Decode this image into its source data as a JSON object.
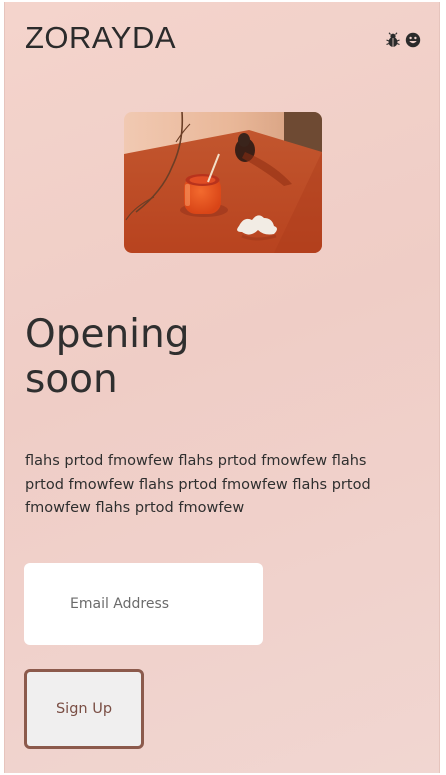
{
  "header": {
    "brand": "ZORAYDA",
    "icons": [
      "bug-icon",
      "smiley-icon"
    ]
  },
  "hero": {
    "image": "drink-on-table-photo"
  },
  "main": {
    "headline": "Opening soon",
    "description": "flahs prtod fmowfew flahs prtod fmowfew flahs prtod fmowfew flahs prtod fmowfew flahs prtod fmowfew flahs prtod fmowfew"
  },
  "form": {
    "email_placeholder": "Email Address",
    "signup_label": "Sign Up"
  },
  "colors": {
    "background": "#f1d3cc",
    "text": "#2f2f2f",
    "button_border": "#8c5a4c",
    "button_text": "#7a4e44"
  }
}
